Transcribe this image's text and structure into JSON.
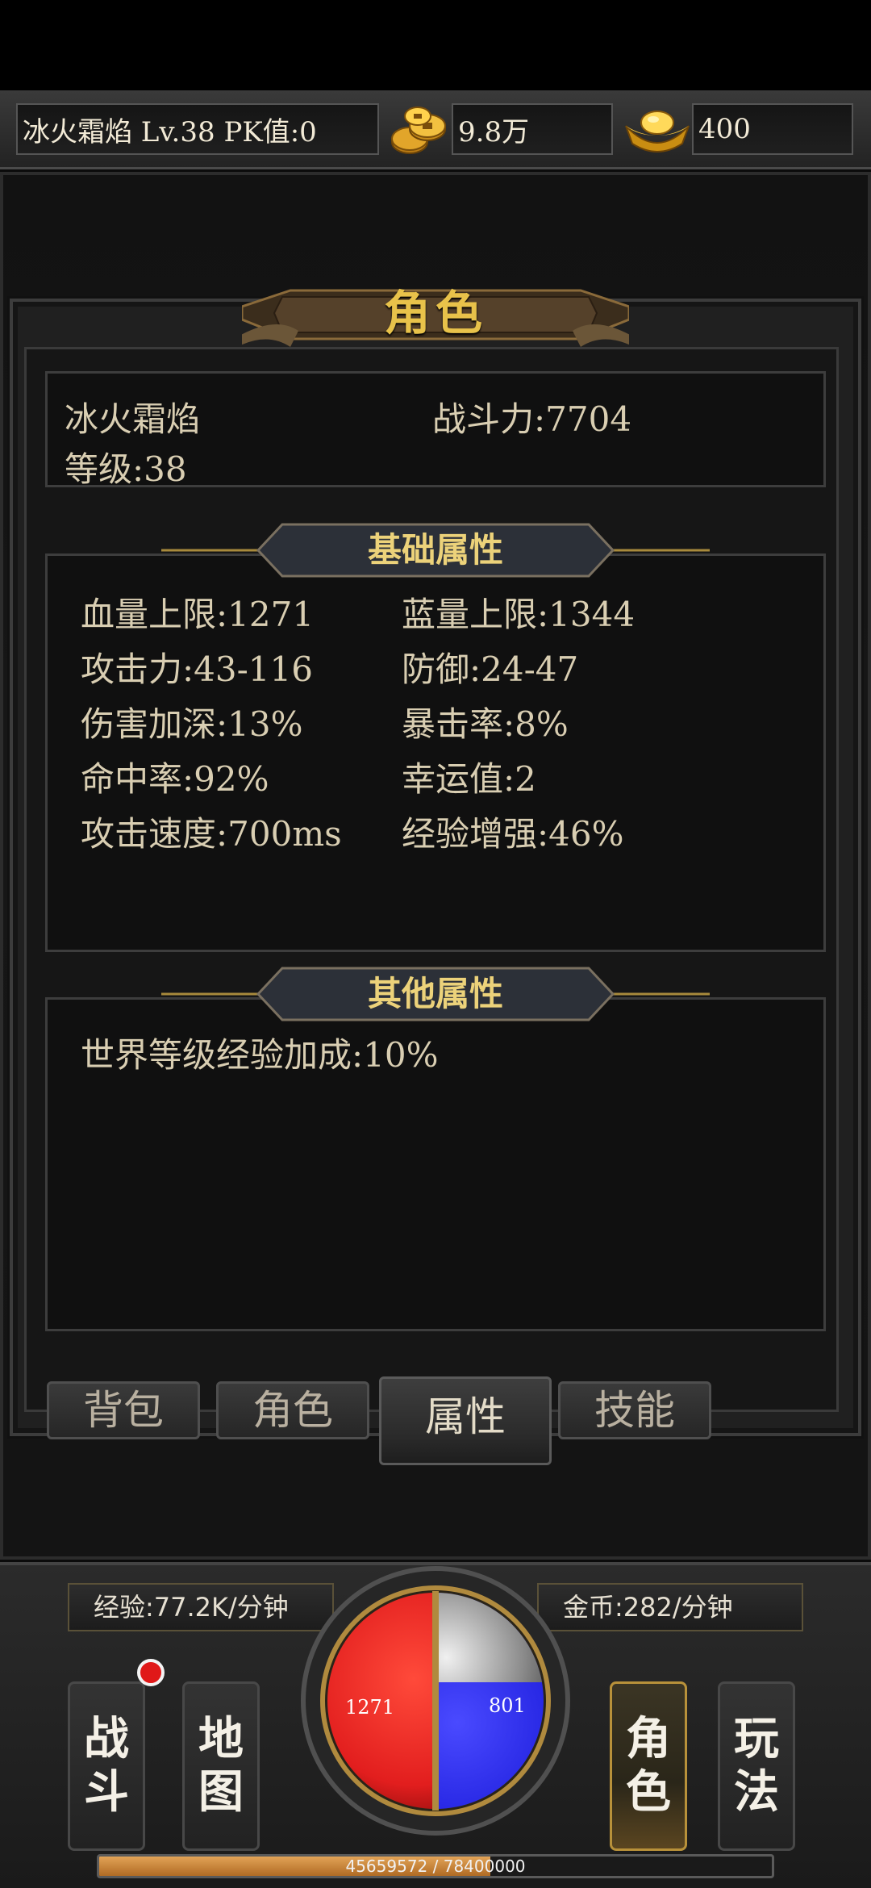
{
  "topbar": {
    "player_info": "冰火霜焰  Lv.38 PK值:0",
    "gold": "9.8万",
    "ingot": "400",
    "gold_icon": "coin-icon",
    "ingot_icon": "ingot-icon"
  },
  "panel": {
    "title": "角色",
    "name": "冰火霜焰",
    "combat_power": "战斗力:7704",
    "level": "等级:38"
  },
  "basic": {
    "header": "基础属性",
    "stats": [
      {
        "left": "血量上限:1271",
        "right": "蓝量上限:1344"
      },
      {
        "left": "攻击力:43-116",
        "right": "防御:24-47"
      },
      {
        "left": "伤害加深:13%",
        "right": "暴击率:8%"
      },
      {
        "left": "命中率:92%",
        "right": "幸运值:2"
      },
      {
        "left": "攻击速度:700ms",
        "right": "经验增强:46%"
      }
    ]
  },
  "other": {
    "header": "其他属性",
    "stats": [
      "世界等级经验加成:10%"
    ]
  },
  "tabs": [
    {
      "label": "背包",
      "active": false
    },
    {
      "label": "角色",
      "active": false
    },
    {
      "label": "属性",
      "active": true
    },
    {
      "label": "技能",
      "active": false
    }
  ],
  "hud": {
    "exp_rate": "经验:77.2K/分钟",
    "gold_rate": "金币:282/分钟",
    "hp": "1271",
    "mp": "801",
    "exp_text": "45659572 / 78400000",
    "exp_progress": 0.582,
    "buttons": [
      {
        "line1": "战",
        "line2": "斗",
        "active": false
      },
      {
        "line1": "地",
        "line2": "图",
        "active": false
      },
      {
        "line1": "角",
        "line2": "色",
        "active": true
      },
      {
        "line1": "玩",
        "line2": "法",
        "active": false
      }
    ]
  },
  "colors": {
    "gold_text": "#e8c24a",
    "hp_red": "#e21e1e",
    "mp_blue": "#2222e0",
    "active_border": "#b8913a"
  }
}
